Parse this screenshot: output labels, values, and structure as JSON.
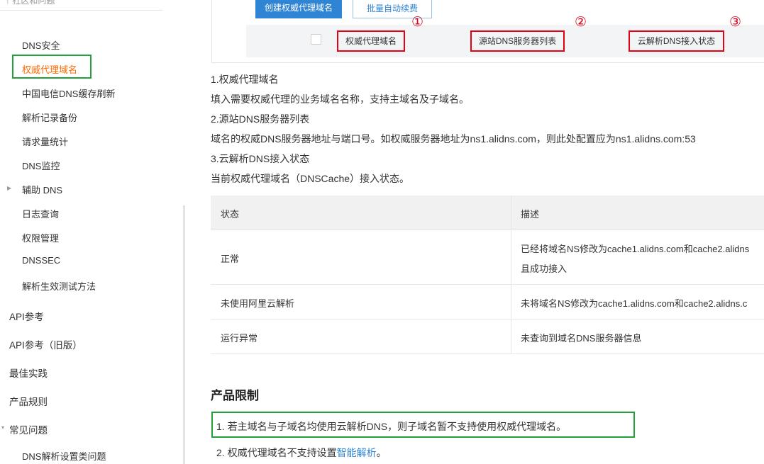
{
  "sidebar": {
    "top_text": "↑ 社区和问题",
    "items": [
      {
        "label": "DNS安全",
        "level": "sub"
      },
      {
        "label": "权威代理域名",
        "level": "sub",
        "active": true
      },
      {
        "label": "中国电信DNS缓存刷新",
        "level": "sub"
      },
      {
        "label": "解析记录备份",
        "level": "sub"
      },
      {
        "label": "请求量统计",
        "level": "sub"
      },
      {
        "label": "DNS监控",
        "level": "sub"
      },
      {
        "label": "辅助 DNS",
        "level": "sub",
        "collapsible": true
      },
      {
        "label": "日志查询",
        "level": "sub"
      },
      {
        "label": "权限管理",
        "level": "sub"
      },
      {
        "label": "DNSSEC",
        "level": "sub"
      },
      {
        "label": "解析生效测试方法",
        "level": "sub"
      },
      {
        "label": "API参考",
        "level": "top"
      },
      {
        "label": "API参考（旧版）",
        "level": "top"
      },
      {
        "label": "最佳实践",
        "level": "top"
      },
      {
        "label": "产品规则",
        "level": "top"
      },
      {
        "label": "常见问题",
        "level": "top",
        "collapsible": true
      },
      {
        "label": "DNS解析设置类问题",
        "level": "sub"
      }
    ],
    "accent_active": "#ff6a00",
    "highlight_color": "#22a03a"
  },
  "screenshot": {
    "btn_create": "创建权威代理域名",
    "btn_renew": "批量自动续费",
    "columns": [
      "权威代理域名",
      "源站DNS服务器列表",
      "云解析DNS接入状态"
    ],
    "markers": [
      "①",
      "②",
      "③"
    ],
    "marker_color": "#e60012"
  },
  "content": {
    "p1_title": "1.权威代理域名",
    "p1_desc": "填入需要权威代理的业务域名名称，支持主域名及子域名。",
    "p2_title": "2.源站DNS服务器列表",
    "p2_desc": "域名的权威DNS服务器地址与端口号。如权威服务器地址为ns1.alidns.com，则此处配置应为ns1.alidns.com:53",
    "p3_title": "3.云解析DNS接入状态",
    "p3_desc": "当前权威代理域名（DNSCache）接入状态。"
  },
  "status_table": {
    "headers": [
      "状态",
      "描述"
    ],
    "rows": [
      {
        "state": "正常",
        "desc_line1": "已经将域名NS修改为cache1.alidns.com和cache2.alidns",
        "desc_line2": "且成功接入"
      },
      {
        "state": "未使用阿里云解析",
        "desc_line1": "未将域名NS修改为cache1.alidns.com和cache2.alidns.c"
      },
      {
        "state": "运行异常",
        "desc_line1": "未查询到域名DNS服务器信息"
      }
    ]
  },
  "limits": {
    "heading": "产品限制",
    "item1": "1. 若主域名与子域名均使用云解析DNS，则子域名暂不支持使用权威代理域名。",
    "item2_prefix": "2. 权威代理域名不支持设置",
    "item2_link": "智能解析",
    "item2_suffix": "。"
  }
}
